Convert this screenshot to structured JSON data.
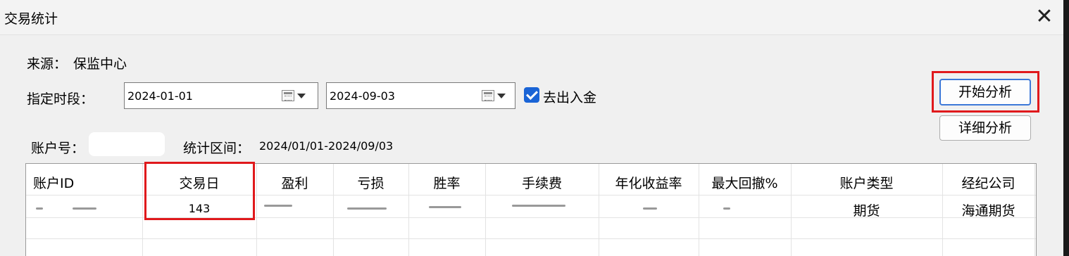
{
  "window": {
    "title": "交易统计",
    "close_glyph": "✕"
  },
  "source": {
    "label": "来源：",
    "value": "保监中心"
  },
  "period": {
    "label": "指定时段：",
    "start_date": "2024-01-01",
    "end_date": "2024-09-03",
    "exclude_deposits_label": "去出入金",
    "exclude_deposits_checked": true
  },
  "account": {
    "label": "账户号：",
    "value": ""
  },
  "range": {
    "label": "统计区间：",
    "value": "2024/01/01-2024/09/03"
  },
  "buttons": {
    "start_analysis": "开始分析",
    "detail_analysis": "详细分析"
  },
  "table": {
    "columns": [
      "账户ID",
      "交易日",
      "盈利",
      "亏损",
      "胜率",
      "手续费",
      "年化收益率",
      "最大回撤%",
      "账户类型",
      "经纪公司"
    ],
    "rows": [
      [
        "",
        "143",
        "",
        "",
        "",
        "",
        "",
        "",
        "期货",
        "海通期货"
      ]
    ]
  },
  "colors": {
    "highlight_red": "#e0191c",
    "checkbox_blue": "#1a64d6",
    "primary_border": "#3c78d8"
  },
  "icons": [
    "calendar-icon",
    "dropdown-arrow-icon",
    "check-icon",
    "close-icon"
  ]
}
